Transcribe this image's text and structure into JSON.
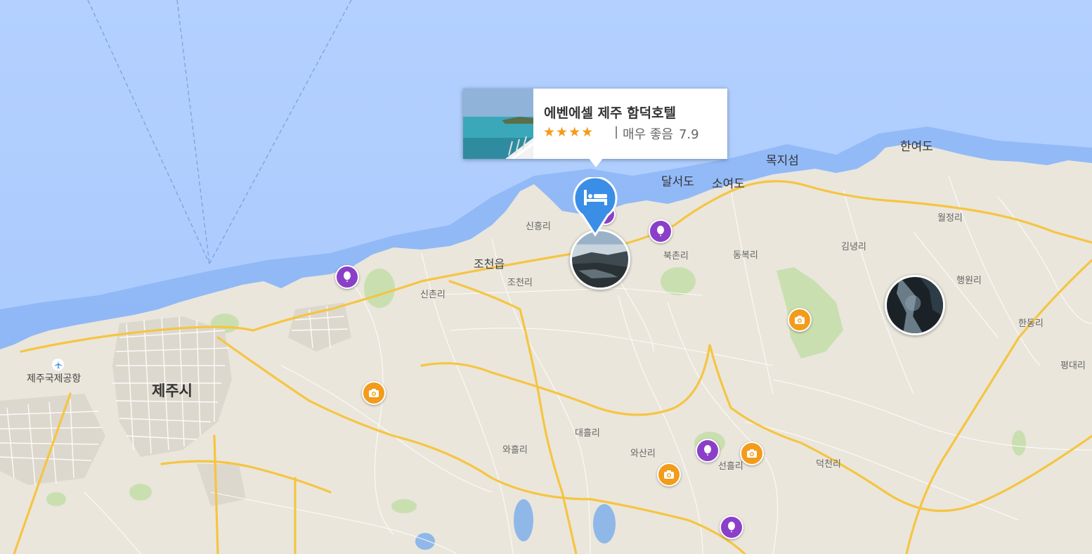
{
  "map": {
    "colors": {
      "sea": "#aacbff",
      "land": "#eae6dc",
      "highway": "#f5c542",
      "park": "#c9dfb0",
      "roads": "#ffffff"
    },
    "labels": [
      {
        "text": "제주시",
        "kind": "city"
      },
      {
        "text": "제주국제공항",
        "kind": "airport"
      },
      {
        "text": "조천읍",
        "kind": "town"
      },
      {
        "text": "조천리",
        "kind": "village"
      },
      {
        "text": "신흥리",
        "kind": "village"
      },
      {
        "text": "신촌리",
        "kind": "village"
      },
      {
        "text": "북촌리",
        "kind": "village"
      },
      {
        "text": "동복리",
        "kind": "village"
      },
      {
        "text": "김녕리",
        "kind": "village"
      },
      {
        "text": "월정리",
        "kind": "village"
      },
      {
        "text": "행원리",
        "kind": "village"
      },
      {
        "text": "한동리",
        "kind": "village"
      },
      {
        "text": "평대리",
        "kind": "village"
      },
      {
        "text": "대흘리",
        "kind": "village"
      },
      {
        "text": "와흘리",
        "kind": "village"
      },
      {
        "text": "와산리",
        "kind": "village"
      },
      {
        "text": "선흘리",
        "kind": "village"
      },
      {
        "text": "덕천리",
        "kind": "village"
      },
      {
        "text": "달서도",
        "kind": "island"
      },
      {
        "text": "소여도",
        "kind": "island"
      },
      {
        "text": "목지섬",
        "kind": "island"
      },
      {
        "text": "한여도",
        "kind": "island"
      }
    ],
    "markers": [
      {
        "type": "poi",
        "icon": "balloon-icon"
      },
      {
        "type": "poi",
        "icon": "balloon-icon"
      },
      {
        "type": "poi",
        "icon": "balloon-icon"
      },
      {
        "type": "poi",
        "icon": "balloon-icon"
      },
      {
        "type": "poi",
        "icon": "balloon-icon"
      },
      {
        "type": "photo",
        "icon": "camera-icon"
      },
      {
        "type": "photo",
        "icon": "camera-icon"
      },
      {
        "type": "photo",
        "icon": "camera-icon"
      },
      {
        "type": "photo",
        "icon": "camera-icon"
      }
    ]
  },
  "hotel": {
    "name": "에벤에셀 제주 함덕호텔",
    "stars": "★★★★",
    "separator": "|",
    "rating_text": "매우 좋음",
    "score": "7.9",
    "icon": "bed-icon"
  }
}
